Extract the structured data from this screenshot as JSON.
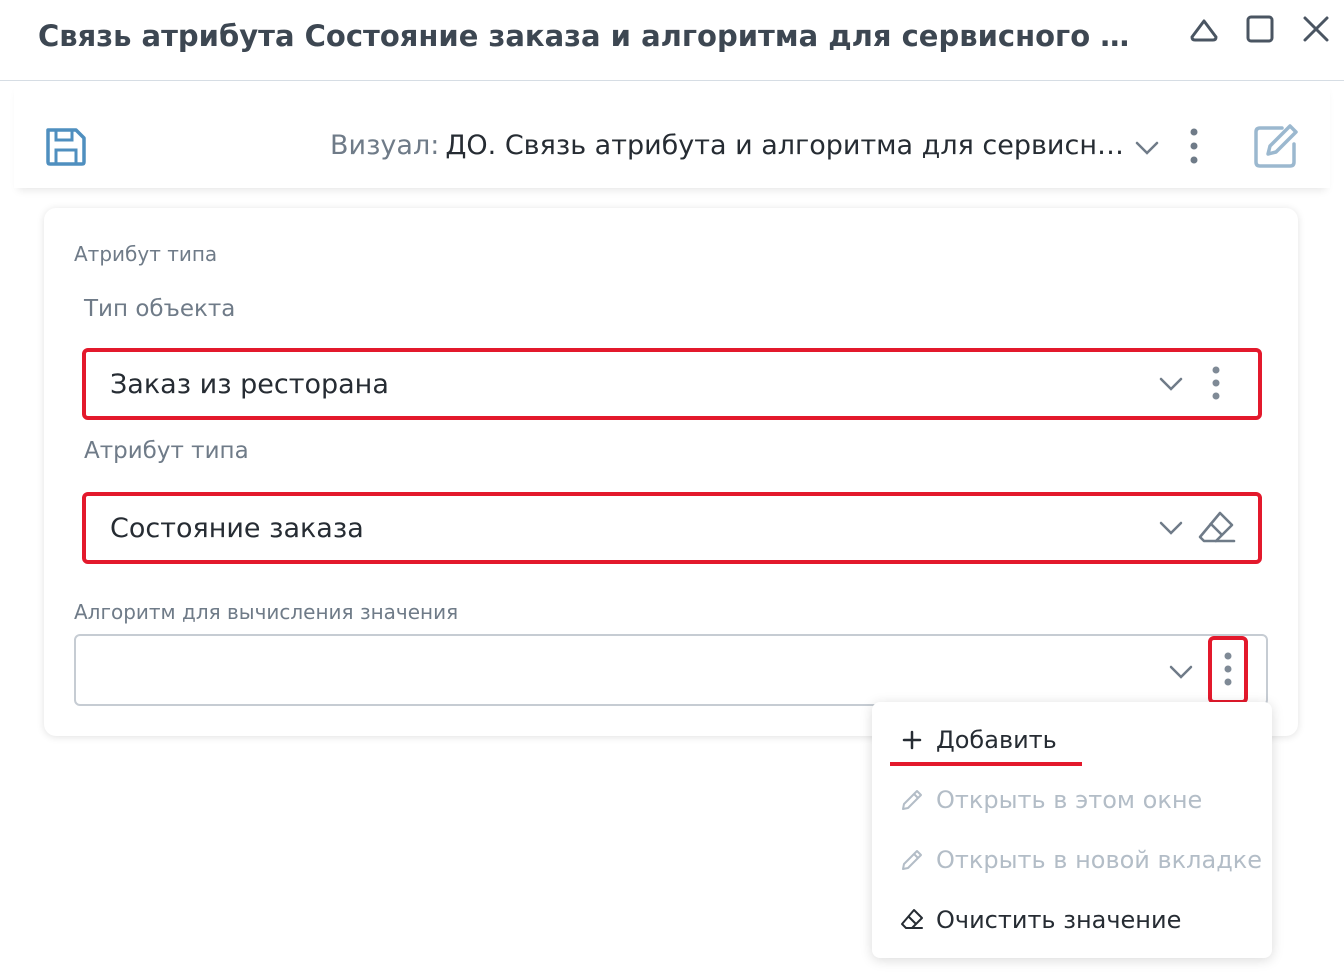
{
  "window": {
    "title": "Связь атрибута Состояние заказа и алгоритма для сервисного действия",
    "controls": [
      "collapse-icon",
      "maximize-icon",
      "close-icon"
    ]
  },
  "toolbar": {
    "visual_label": "Визуал:",
    "visual_value": "ДО. Связь атрибута и алгоритма для сервисного действия"
  },
  "form": {
    "section_title": "Атрибут типа",
    "object_type": {
      "label": "Тип объекта",
      "value": "Заказ из ресторана"
    },
    "type_attribute": {
      "label": "Атрибут типа",
      "value": "Состояние заказа"
    },
    "algorithm": {
      "label": "Алгоритм для вычисления значения",
      "value": ""
    }
  },
  "context_menu": {
    "items": [
      {
        "label": "Добавить",
        "icon": "plus-icon",
        "enabled": true
      },
      {
        "label": "Открыть в этом окне",
        "icon": "pencil-icon",
        "enabled": false
      },
      {
        "label": "Открыть в новой вкладке",
        "icon": "pencil-icon",
        "enabled": false
      },
      {
        "label": "Очистить значение",
        "icon": "eraser-icon",
        "enabled": true
      }
    ]
  },
  "colors": {
    "highlight": "#e3192c",
    "accent_icon": "#4f8fbf",
    "disabled_text": "#b3bdc7"
  }
}
